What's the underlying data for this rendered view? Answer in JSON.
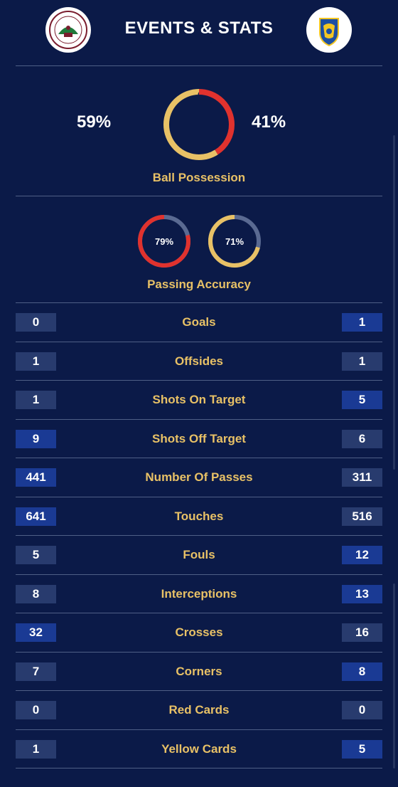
{
  "header": {
    "title": "EVENTS & STATS",
    "home_team_crest": "mohun-bagan-crest",
    "away_team_crest": "kerala-blasters-crest"
  },
  "possession": {
    "label": "Ball Possession",
    "home_pct": "59%",
    "away_pct": "41%",
    "home_value": 0.59,
    "away_value": 0.41,
    "home_color": "#e8c166",
    "away_color": "#e0322e"
  },
  "passing": {
    "label": "Passing Accuracy",
    "home_pct": "79%",
    "away_pct": "71%",
    "home_value": 0.79,
    "away_value": 0.71,
    "home_color": "#e0322e",
    "away_color": "#e8c166",
    "track_color": "#5a6a92"
  },
  "stats": [
    {
      "label": "Goals",
      "home": "0",
      "away": "1"
    },
    {
      "label": "Offsides",
      "home": "1",
      "away": "1"
    },
    {
      "label": "Shots On Target",
      "home": "1",
      "away": "5"
    },
    {
      "label": "Shots Off Target",
      "home": "9",
      "away": "6"
    },
    {
      "label": "Number Of Passes",
      "home": "441",
      "away": "311"
    },
    {
      "label": "Touches",
      "home": "641",
      "away": "516"
    },
    {
      "label": "Fouls",
      "home": "5",
      "away": "12"
    },
    {
      "label": "Interceptions",
      "home": "8",
      "away": "13"
    },
    {
      "label": "Crosses",
      "home": "32",
      "away": "16"
    },
    {
      "label": "Corners",
      "home": "7",
      "away": "8"
    },
    {
      "label": "Red Cards",
      "home": "0",
      "away": "0"
    },
    {
      "label": "Yellow Cards",
      "home": "1",
      "away": "5"
    }
  ],
  "colors": {
    "background": "#0b1a48",
    "gold": "#e8c166",
    "red": "#e0322e",
    "box_leading": "#1a3a94",
    "box_trailing": "#283b6e"
  }
}
